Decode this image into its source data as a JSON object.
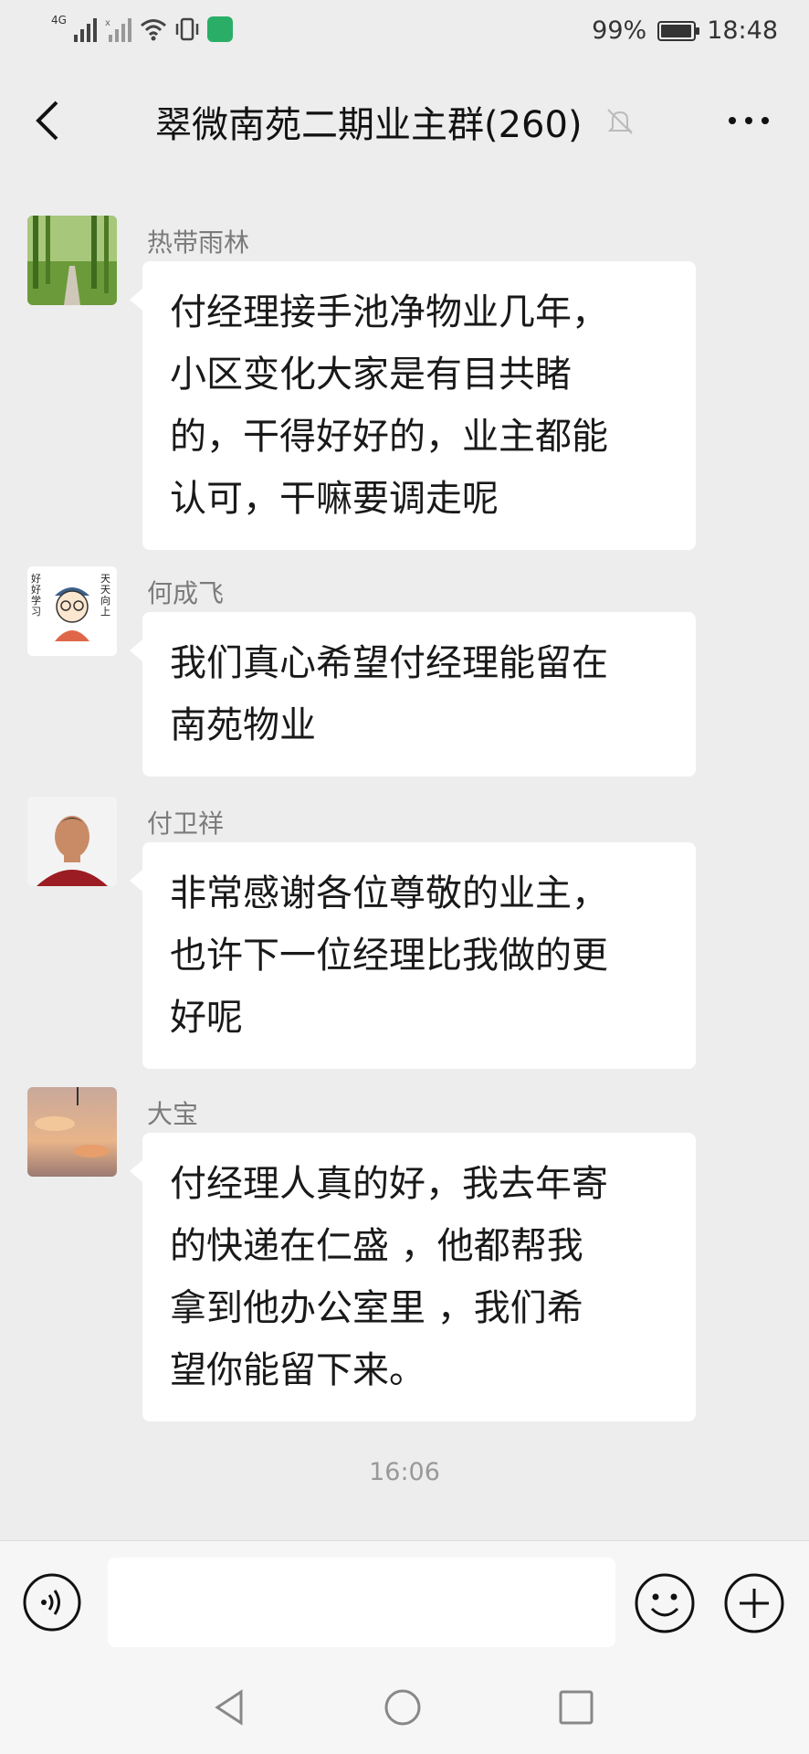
{
  "status_bar": {
    "network": "4G",
    "battery": "99%",
    "time": "18:48"
  },
  "header": {
    "title": "翠微南苑二期业主群(260)",
    "back_icon": "chevron-left-icon",
    "mute_icon": "bell-muted-icon",
    "more_icon": "more-dots-icon"
  },
  "messages": [
    {
      "sender": "热带雨林",
      "lines": [
        "付经理接手池净物业几年，",
        "小区变化大家是有目共睹",
        "的，干得好好的，业主都能",
        "认可，干嘛要调走呢"
      ]
    },
    {
      "sender": "何成飞",
      "avatar_text_left": "好好学习",
      "avatar_text_right": "天天向上",
      "lines": [
        "我们真心希望付经理能留在",
        "南苑物业"
      ]
    },
    {
      "sender": "付卫祥",
      "lines": [
        "非常感谢各位尊敬的业主，",
        "也许下一位经理比我做的更",
        "好呢"
      ]
    },
    {
      "sender": "大宝",
      "lines": [
        "付经理人真的好，我去年寄",
        "的快递在仁盛 ，他都帮我",
        "拿到他办公室里  ，我们希",
        "望你能留下来。"
      ]
    }
  ],
  "timestamp": "16:06",
  "input_bar": {
    "voice_icon": "voice-icon",
    "emoji_icon": "emoji-icon",
    "plus_icon": "plus-circle-icon",
    "input_value": ""
  },
  "navbar": {
    "back_icon": "triangle-back-icon",
    "home_icon": "circle-home-icon",
    "recent_icon": "square-recent-icon"
  }
}
